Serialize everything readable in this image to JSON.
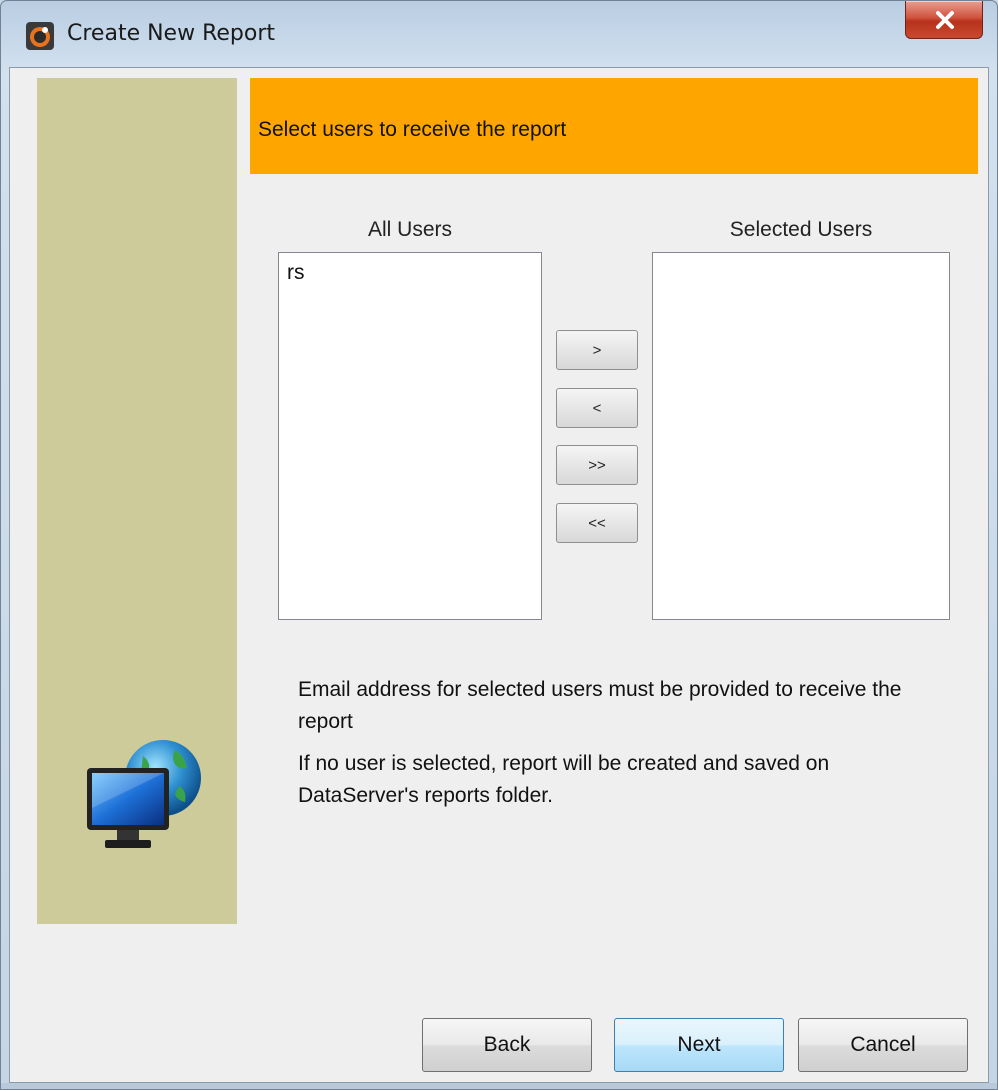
{
  "window": {
    "title": "Create New Report"
  },
  "header": {
    "instruction": "Select users to receive the report"
  },
  "all_users": {
    "label": "All Users",
    "items": [
      "rs"
    ]
  },
  "selected_users": {
    "label": "Selected Users",
    "items": []
  },
  "transfer_buttons": {
    "add_one": ">",
    "remove_one": "<",
    "add_all": ">>",
    "remove_all": "<<"
  },
  "info": {
    "email_note": "Email address for selected users must be provided to receive the report",
    "no_user_note": "If no user is selected, report will be created and saved on DataServer's reports folder."
  },
  "footer": {
    "back_label": "Back",
    "next_label": "Next",
    "cancel_label": "Cancel"
  },
  "icons": {
    "app": "app-icon",
    "close": "close-icon",
    "wizard": "monitor-globe-icon"
  },
  "colors": {
    "banner": "#ffa500",
    "sidebar": "#cdcb9a",
    "panel": "#efefef"
  }
}
